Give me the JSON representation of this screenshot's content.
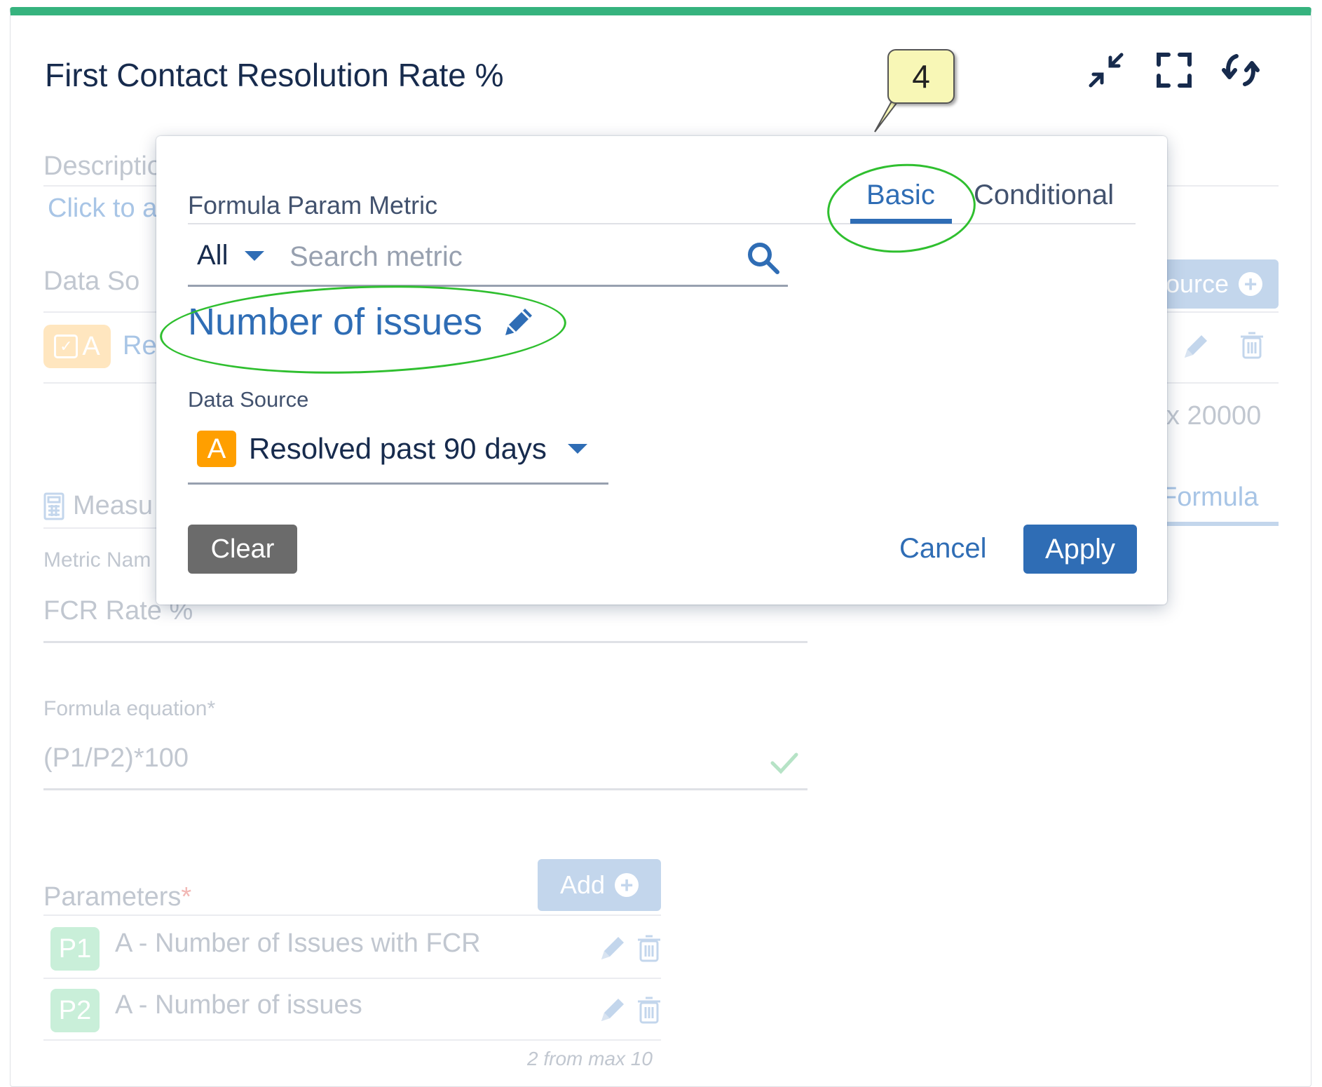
{
  "header": {
    "title": "First Contact Resolution Rate %",
    "icons": [
      "collapse-icon",
      "fullscreen-icon",
      "refresh-icon"
    ]
  },
  "background_form": {
    "description_label": "Descriptio",
    "description_link": "Click to a",
    "data_source_label": "Data So",
    "data_source_badge": "A",
    "data_source_row_text": "Re",
    "add_source_button": "ource",
    "max_text": "x 20000",
    "formula_tab": "Formula",
    "measure_label": "Measu",
    "metric_name_label": "Metric Nam",
    "metric_name_value": "FCR Rate %",
    "formula_equation_label": "Formula equation*",
    "formula_equation_value": "(P1/P2)*100",
    "parameters_label": "Parameters",
    "parameters_required": "*",
    "add_button": "Add",
    "parameters": [
      {
        "badge": "P1",
        "text": "A - Number of Issues with FCR"
      },
      {
        "badge": "P2",
        "text": "A - Number of issues"
      }
    ],
    "parameters_count": "2 from max 10"
  },
  "callout": {
    "number": "4"
  },
  "modal": {
    "title_label": "Formula Param Metric",
    "tabs": [
      {
        "label": "Basic",
        "active": true
      },
      {
        "label": "Conditional",
        "active": false
      }
    ],
    "filter_value": "All",
    "search_placeholder": "Search metric",
    "selected_metric": "Number of issues",
    "data_source_label": "Data Source",
    "data_source_badge": "A",
    "data_source_value": "Resolved past 90 days",
    "buttons": {
      "clear": "Clear",
      "cancel": "Cancel",
      "apply": "Apply"
    }
  },
  "colors": {
    "accent": "#2f6db5",
    "top_bar": "#36b37e",
    "source_badge": "#ff9f00",
    "highlight_ellipse": "#2fbf2f",
    "callout_bg": "#f8f7b6"
  }
}
